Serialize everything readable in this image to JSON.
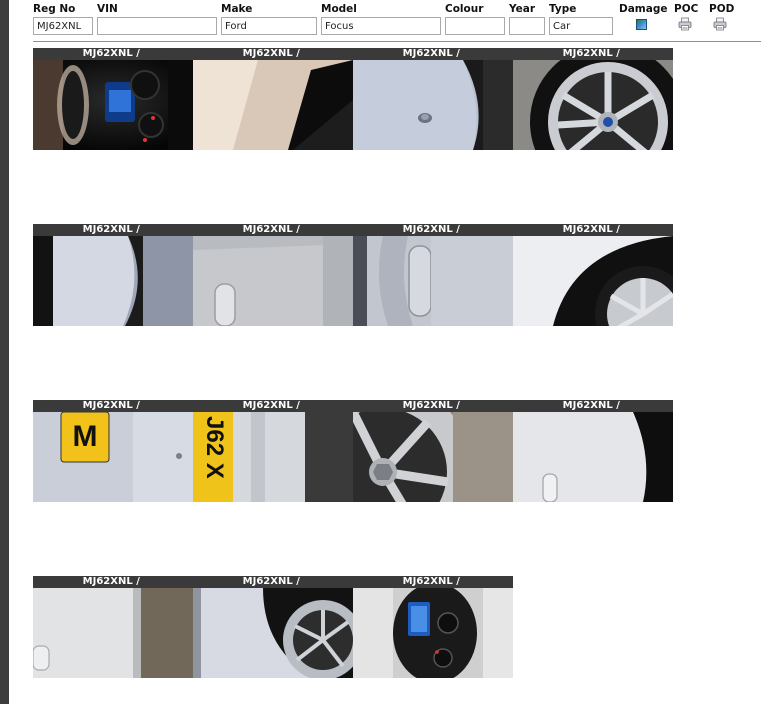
{
  "vehicle_form": {
    "headers": {
      "reg_no": "Reg No",
      "vin": "VIN",
      "make": "Make",
      "model": "Model",
      "colour": "Colour",
      "year": "Year",
      "type": "Type",
      "damage": "Damage",
      "poc": "POC",
      "pod": "POD"
    },
    "values": {
      "reg_no": "MJ62XNL",
      "vin": "",
      "make": "Ford",
      "model": "Focus",
      "colour": "",
      "year": "",
      "type": "Car"
    },
    "icons": {
      "damage": "damage-image-icon",
      "poc": "printer-icon",
      "pod": "printer-icon"
    }
  },
  "photos": [
    [
      {
        "label": "MJ62XNL / ",
        "subject": "dashboard-cluster"
      },
      {
        "label": "MJ62XNL / ",
        "subject": "door-interior"
      },
      {
        "label": "MJ62XNL / ",
        "subject": "bumper-sensor"
      },
      {
        "label": "MJ62XNL / ",
        "subject": "alloy-wheel"
      }
    ],
    [
      {
        "label": "MJ62XNL / ",
        "subject": "wheel-arch"
      },
      {
        "label": "MJ62XNL / ",
        "subject": "door-handle"
      },
      {
        "label": "MJ62XNL / ",
        "subject": "door-handle-side"
      },
      {
        "label": "MJ62XNL / ",
        "subject": "wheel-arch-tyre"
      }
    ],
    [
      {
        "label": "MJ62XNL / ",
        "subject": "rear-plate"
      },
      {
        "label": "MJ62XNL / ",
        "subject": "front-plate"
      },
      {
        "label": "MJ62XNL / ",
        "subject": "wheel-nut"
      },
      {
        "label": "MJ62XNL / ",
        "subject": "rear-door"
      }
    ],
    [
      {
        "label": "MJ62XNL / ",
        "subject": "door-lower"
      },
      {
        "label": "MJ62XNL / ",
        "subject": "alloy-wheel-side"
      },
      {
        "label": "MJ62XNL / ",
        "subject": "dashboard-cluster-2"
      }
    ]
  ],
  "plate_text": {
    "rear": "M",
    "front": "J62 X"
  }
}
